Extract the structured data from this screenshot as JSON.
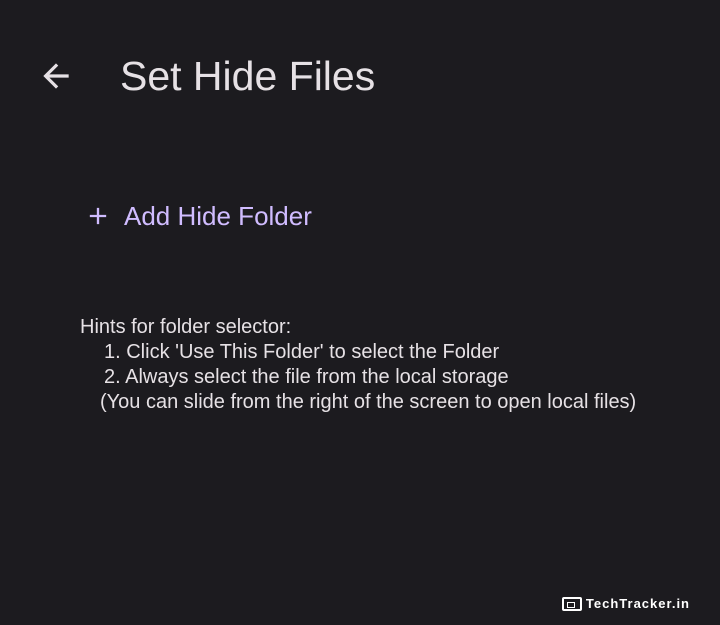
{
  "app_bar": {
    "back_icon": "arrow-left-icon",
    "title": "Set Hide Files"
  },
  "actions": {
    "add_icon": "plus-icon",
    "add_folder_label": "Add Hide Folder"
  },
  "hints": {
    "heading": "Hints for folder selector:",
    "item_1": "1. Click 'Use This Folder' to select the Folder",
    "item_2": "2. Always select the file from the local storage",
    "note": "(You can slide from the right of the screen to open local files)"
  },
  "watermark": {
    "text": "TechTracker.in"
  },
  "colors": {
    "background": "#1c1b1f",
    "text": "#e6e1e5",
    "accent": "#d0bcff"
  }
}
